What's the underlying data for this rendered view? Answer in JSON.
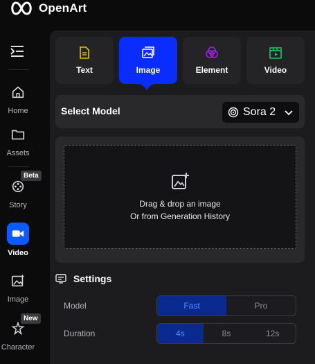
{
  "app": {
    "name": "OpenArt"
  },
  "sidebar": {
    "items": [
      {
        "label": "Home",
        "icon": "home-icon"
      },
      {
        "label": "Assets",
        "icon": "folder-icon"
      },
      {
        "label": "Story",
        "icon": "film-reel-icon",
        "badge": "Beta"
      },
      {
        "label": "Video",
        "icon": "video-camera-icon",
        "active": true
      },
      {
        "label": "Image",
        "icon": "image-sparkle-icon"
      },
      {
        "label": "Character",
        "icon": "character-icon",
        "badge": "New"
      }
    ]
  },
  "tabs": [
    {
      "label": "Text",
      "icon": "text-doc-icon",
      "color": "#e6c200"
    },
    {
      "label": "Image",
      "icon": "image-icon",
      "active": true
    },
    {
      "label": "Element",
      "icon": "element-circles-icon",
      "color": "#a020f0"
    },
    {
      "label": "Video",
      "icon": "clapper-icon",
      "color": "#22c55e"
    }
  ],
  "model": {
    "title": "Select Model",
    "value": "Sora 2"
  },
  "upload": {
    "line1": "Drag & drop an image",
    "line2": "Or from Generation History"
  },
  "settings": {
    "title": "Settings",
    "model_label": "Model",
    "model_options": [
      "Fast",
      "Pro"
    ],
    "model_selected": "Fast",
    "duration_label": "Duration",
    "duration_options": [
      "4s",
      "8s",
      "12s"
    ],
    "duration_selected": "4s"
  },
  "colors": {
    "accent": "#0b2cff",
    "active_video": "#0b5cff",
    "panel": "#1c1c1e"
  }
}
